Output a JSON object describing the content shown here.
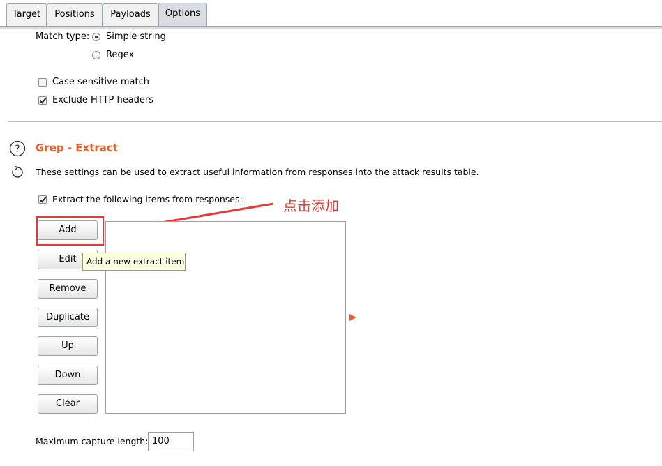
{
  "tabs": [
    {
      "label": "Target"
    },
    {
      "label": "Positions"
    },
    {
      "label": "Payloads"
    },
    {
      "label": "Options"
    }
  ],
  "match": {
    "label": "Match type:",
    "options": [
      "Simple string",
      "Regex"
    ],
    "selected": "Simple string"
  },
  "checks": {
    "case_sensitive": {
      "label": "Case sensitive match",
      "checked": false
    },
    "exclude_headers": {
      "label": "Exclude HTTP headers",
      "checked": true
    }
  },
  "grep_extract": {
    "title": "Grep - Extract",
    "description": "These settings can be used to extract useful information from responses into the attack results table.",
    "extract_check": {
      "label": "Extract the following items from responses:",
      "checked": true
    },
    "buttons": [
      "Add",
      "Edit",
      "Remove",
      "Duplicate",
      "Up",
      "Down",
      "Clear"
    ],
    "tooltip": "Add a new extract item",
    "max_capture": {
      "label": "Maximum capture length:",
      "value": "100"
    }
  },
  "annotation": {
    "text": "点击添加",
    "color": "#e53935"
  },
  "colors": {
    "accent": "#e8632b",
    "annotation_red": "#e53935",
    "tab_active": "#d9dde2"
  },
  "icons": [
    "help-icon",
    "refresh-icon",
    "expand-arrow-icon"
  ]
}
